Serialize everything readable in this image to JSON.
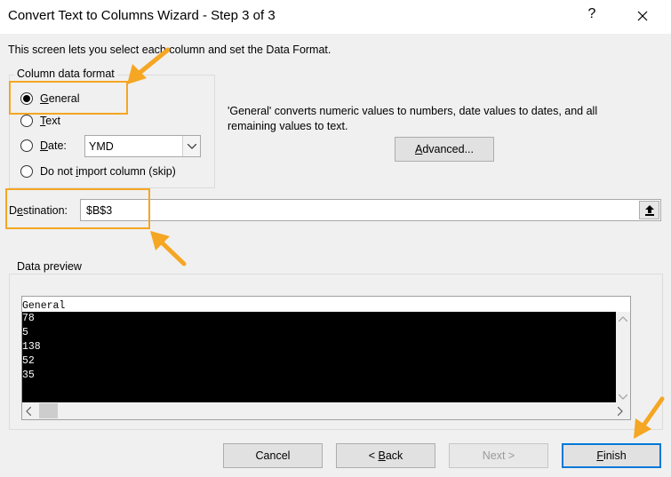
{
  "window": {
    "title": "Convert Text to Columns Wizard - Step 3 of 3",
    "help": "?",
    "close_icon": "close-icon"
  },
  "description": "This screen lets you select each column and set the Data Format.",
  "column_format": {
    "legend": "Column data format",
    "options": [
      {
        "prefix": "",
        "mnemonic": "G",
        "rest": "eneral",
        "selected": true
      },
      {
        "prefix": "",
        "mnemonic": "T",
        "rest": "ext",
        "selected": false
      },
      {
        "prefix": "",
        "mnemonic": "D",
        "rest": "ate:",
        "selected": false
      },
      {
        "prefix": "Do not ",
        "mnemonic": "i",
        "rest": "mport column (skip)",
        "selected": false
      }
    ],
    "date_format": "YMD"
  },
  "info_text": "'General' converts numeric values to numbers, date values to dates, and all remaining values to text.",
  "advanced": {
    "mnemonic": "A",
    "rest": "dvanced..."
  },
  "destination": {
    "prefix": "D",
    "mnemonic": "e",
    "rest": "stination:",
    "value": "$B$3"
  },
  "preview": {
    "legend": "Data preview",
    "header": "General",
    "rows": [
      "78",
      "5",
      "138",
      "52",
      "35"
    ]
  },
  "buttons": {
    "cancel": "Cancel",
    "back_prefix": "< ",
    "back_mnemonic": "B",
    "back_rest": "ack",
    "next": "Next >",
    "finish_mnemonic": "F",
    "finish_rest": "inish"
  },
  "colors": {
    "annotation": "#f5a623",
    "accent": "#0078d7"
  }
}
